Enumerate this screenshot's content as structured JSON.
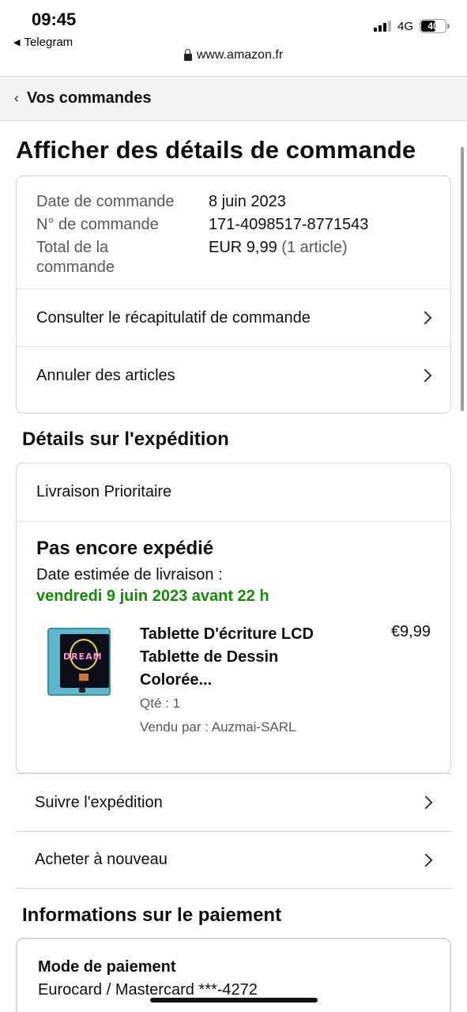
{
  "status_bar": {
    "time": "09:45",
    "back_app": "Telegram",
    "network": "4G",
    "battery": "40",
    "url": "www.amazon.fr"
  },
  "breadcrumb": {
    "label": "Vos commandes"
  },
  "page_title": "Afficher des détails de commande",
  "order_summary": {
    "date_label": "Date de commande",
    "date_value": "8 juin 2023",
    "number_label": "N° de commande",
    "number_value": "171-4098517-8771543",
    "total_label_line1": "Total de la",
    "total_label_line2": "commande",
    "total_value": "EUR 9,99",
    "total_count": "(1 article)",
    "links": [
      {
        "label": "Consulter le récapitulatif de commande"
      },
      {
        "label": "Annuler des articles"
      }
    ]
  },
  "shipping": {
    "section_title": "Détails sur l'expédition",
    "ship_type": "Livraison Prioritaire",
    "status": "Pas encore expédié",
    "eta_label": "Date estimée de livraison :",
    "eta_date": "vendredi 9 juin 2023 avant 22 h",
    "item": {
      "title_line1": "Tablette D'écriture LCD",
      "title_line2": "Tablette de Dessin",
      "title_line3": "Colorée...",
      "qty": "Qté : 1",
      "seller": "Vendu par : Auzmai-SARL",
      "price": "€9,99",
      "image_text": "DREAM"
    },
    "actions": [
      {
        "label": "Suivre l'expédition"
      },
      {
        "label": "Acheter à nouveau"
      }
    ]
  },
  "payment": {
    "section_title": "Informations sur le paiement",
    "method_label": "Mode de paiement",
    "method_value": "Eurocard / Mastercard  ***-4272"
  },
  "colors": {
    "eta_green": "#188a0a",
    "border": "#d5d9d9",
    "muted_text": "#565959"
  },
  "icons": [
    "back-triangle-icon",
    "signal-icon",
    "battery-icon",
    "lock-icon",
    "chevron-left-icon",
    "chevron-right-icon"
  ]
}
